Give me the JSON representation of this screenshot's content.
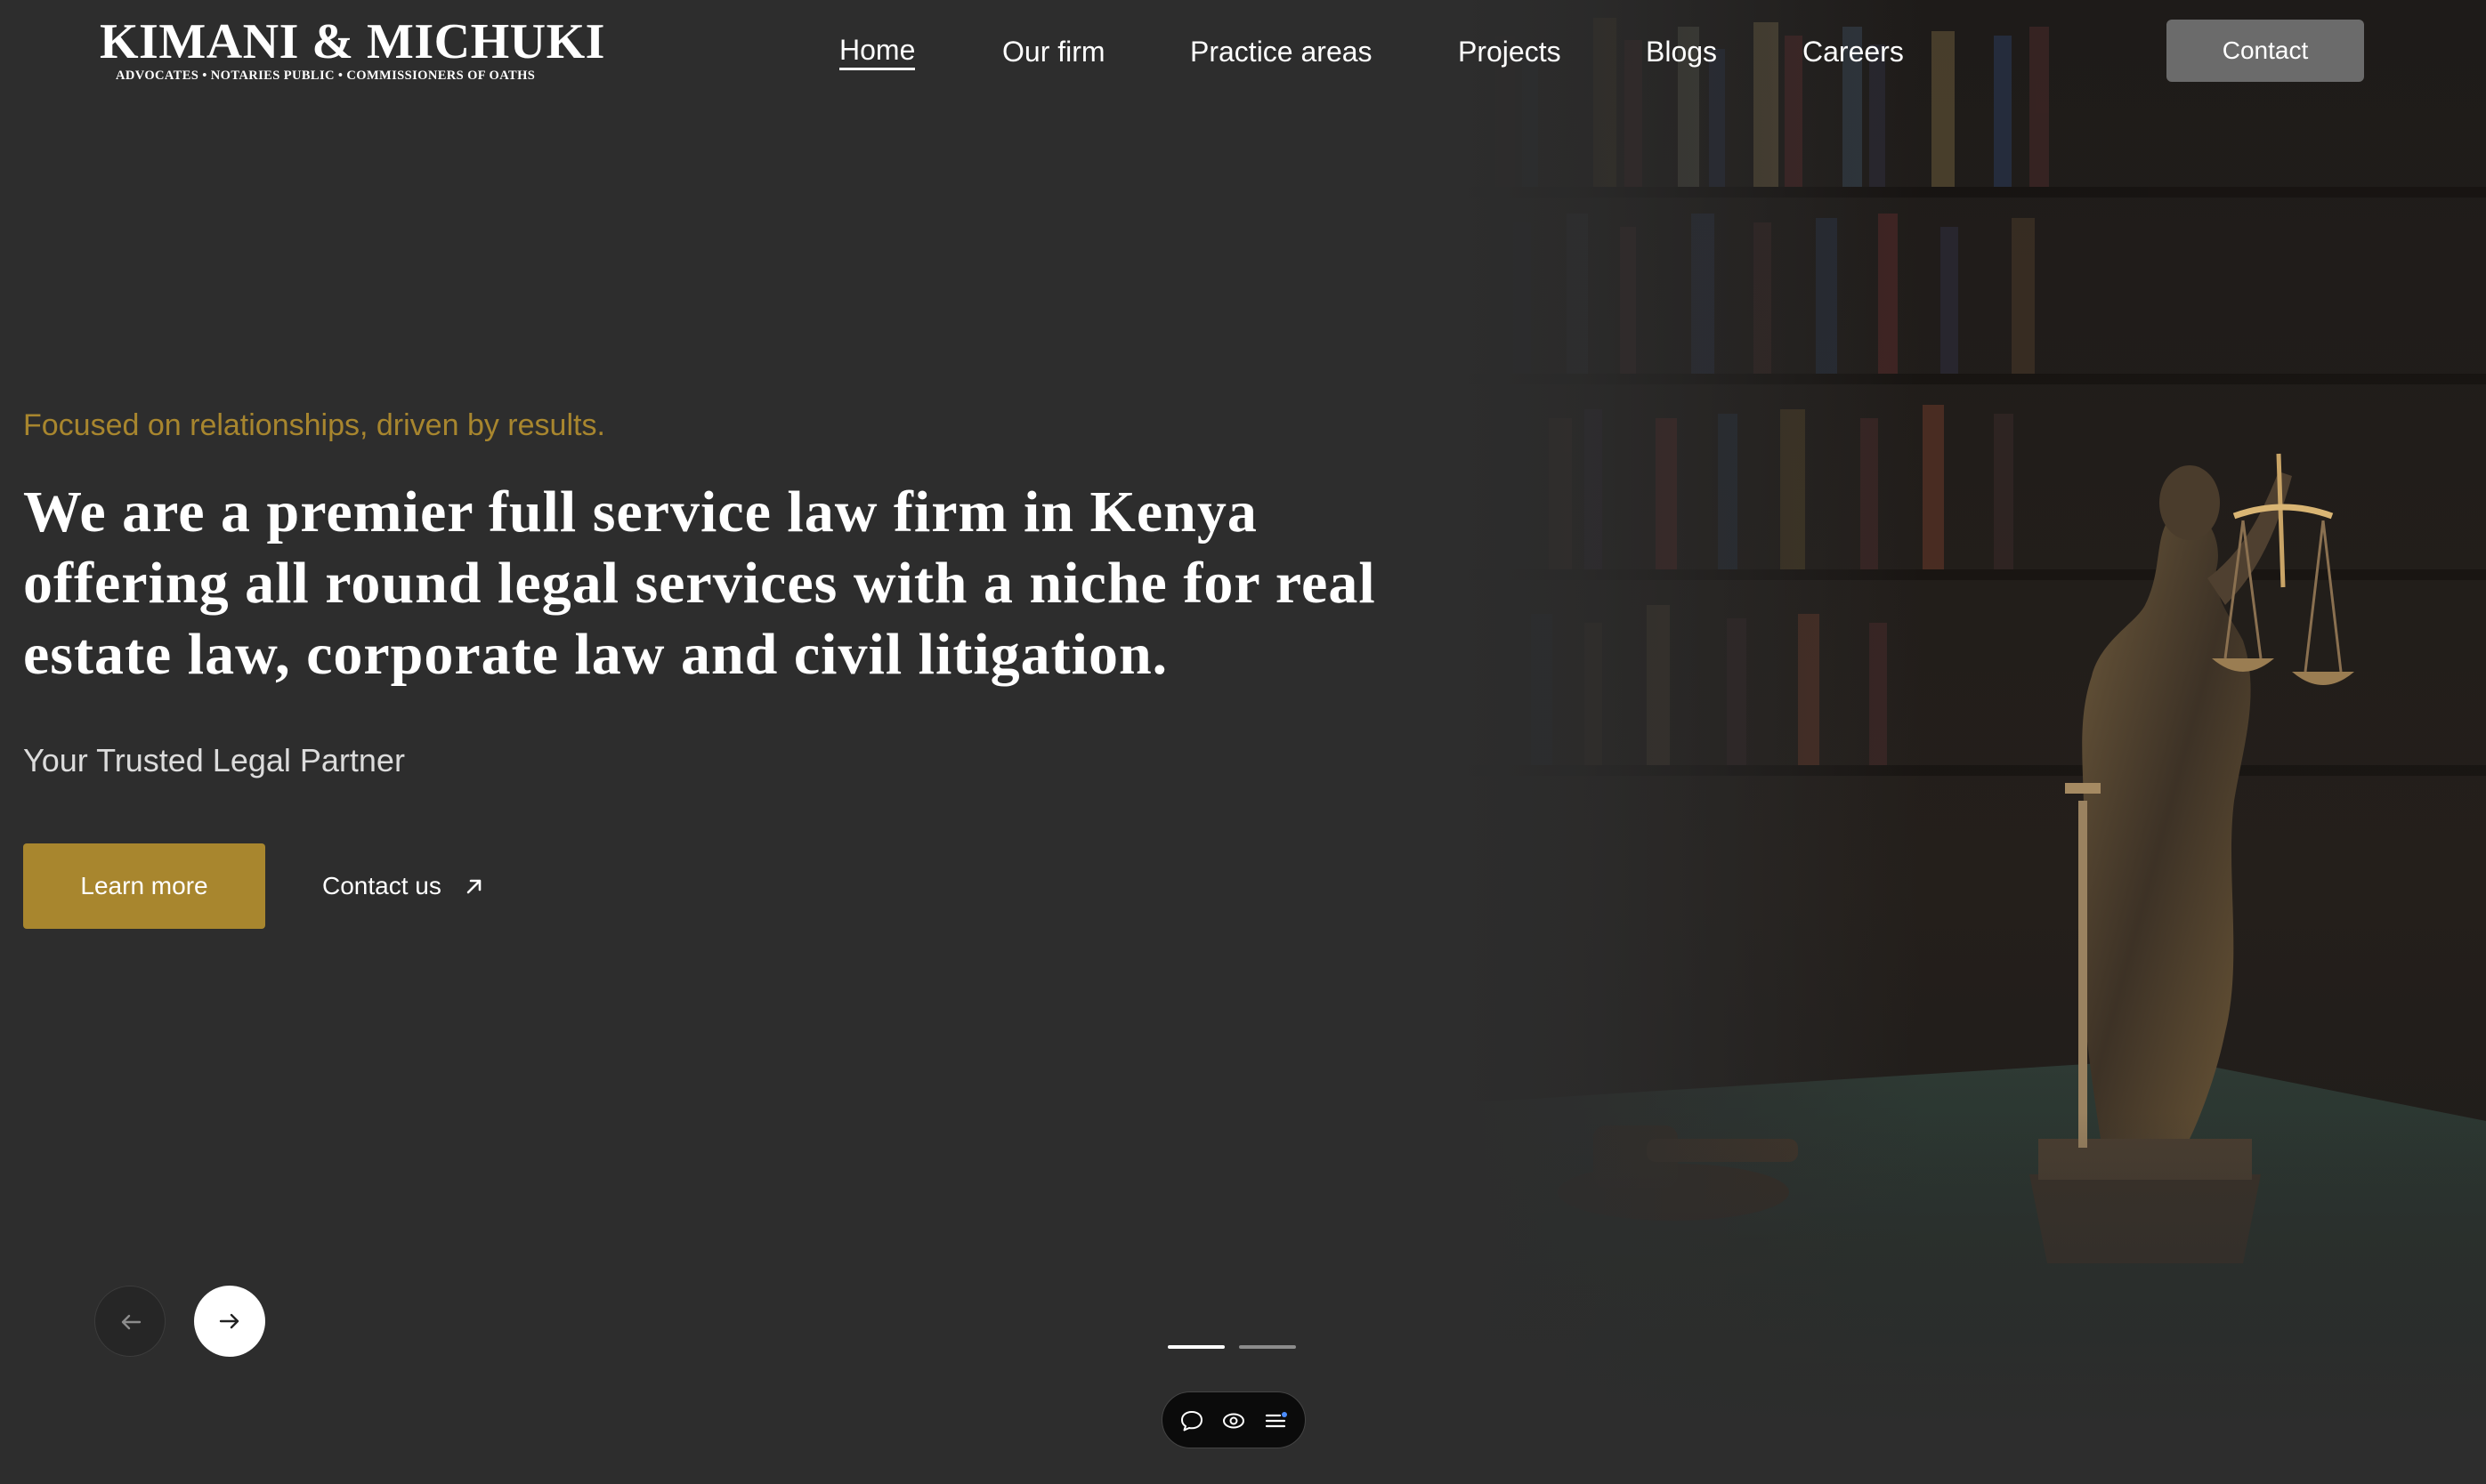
{
  "brand": {
    "name": "KIMANI & MICHUKI",
    "subtitle": "ADVOCATES • NOTARIES PUBLIC • COMMISSIONERS OF OATHS"
  },
  "nav": {
    "items": [
      {
        "label": "Home",
        "active": true
      },
      {
        "label": "Our firm",
        "active": false
      },
      {
        "label": "Practice areas",
        "active": false
      },
      {
        "label": "Projects",
        "active": false
      },
      {
        "label": "Blogs",
        "active": false
      },
      {
        "label": "Careers",
        "active": false
      }
    ],
    "contact_label": "Contact"
  },
  "hero": {
    "eyebrow": "Focused on relationships, driven by results.",
    "headline": "We are a premier full service law firm in Kenya offering all round legal services with a niche for real estate law, corporate law and civil litigation.",
    "tagline": "Your Trusted Legal Partner",
    "primary_cta": "Learn more",
    "secondary_cta": "Contact us",
    "image": "lady-justice-statue-library"
  },
  "slider": {
    "slide_count": 2,
    "current_slide": 1,
    "prev_icon": "arrow-left-icon",
    "next_icon": "arrow-right-icon"
  },
  "toolbar": {
    "tools": [
      "chat-bubble-icon",
      "eye-icon",
      "list-icon"
    ]
  },
  "colors": {
    "background": "#2d2d2d",
    "accent": "#a8862e",
    "text": "#ffffff",
    "contact_button": "#6b6b6b"
  }
}
